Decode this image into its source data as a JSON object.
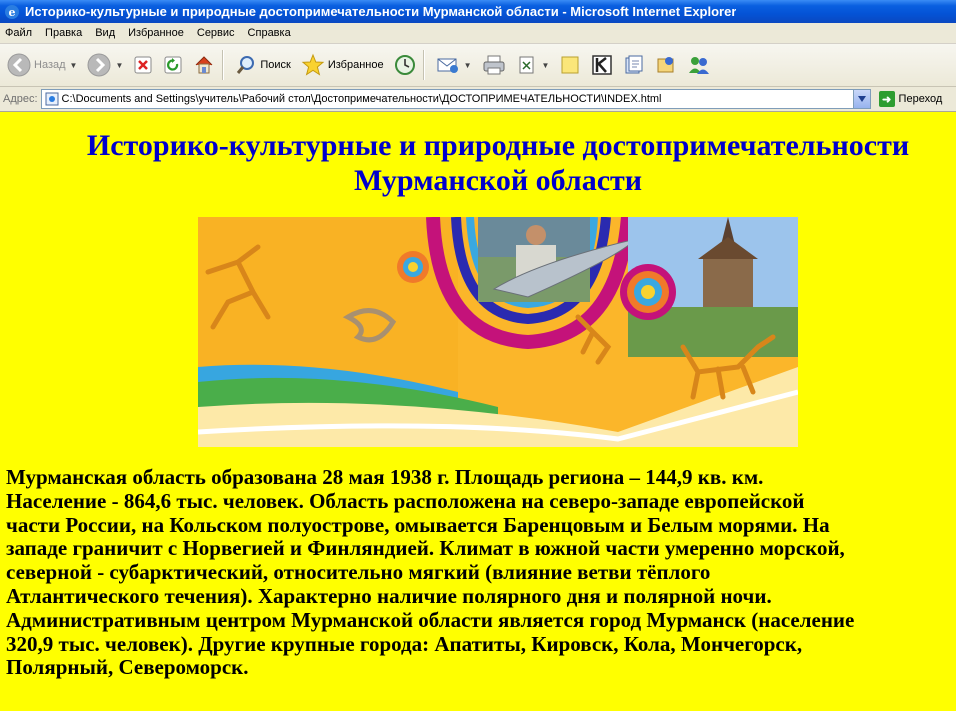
{
  "window": {
    "title": "Историко-культурные и природные достопримечательности Мурманской области - Microsoft Internet Explorer"
  },
  "menu": [
    "Файл",
    "Правка",
    "Вид",
    "Избранное",
    "Сервис",
    "Справка"
  ],
  "toolbar": {
    "back_label": "Назад",
    "search_label": "Поиск",
    "favorites_label": "Избранное"
  },
  "address": {
    "label": "Адрес:",
    "url": "C:\\Documents and Settings\\учитель\\Рабочий стол\\Достопримечательности\\ДОСТОПРИМЕЧАТЕЛЬНОСТИ\\INDEX.html",
    "go_label": "Переход"
  },
  "page": {
    "title_line1": "Историко-культурные и природные достопримечательности",
    "title_line2": "Мурманской области",
    "body_lines": [
      "Мурманская область образована 28 мая 1938 г. Площадь региона – 144,9 кв. км.",
      "Население - 864,6 тыс. человек. Область расположена на северо-западе европейской",
      "части России, на Кольском полуострове, омывается Баренцовым и Белым морями. На",
      "западе граничит с Норвегией и Финляндией. Климат в южной части умеренно морской,",
      "северной - субарктический, относительно мягкий (влияние ветви тёплого",
      "Атлантического течения). Характерно наличие полярного дня и полярной ночи.",
      "Административным центром Мурманской области является город Мурманск (население",
      "320,9 тыс. человек). Другие крупные города: Апатиты, Кировск, Кола, Мончегорск,",
      "Полярный, Североморск."
    ]
  },
  "colors": {
    "page_background": "#ffff00",
    "title_color": "#0000cc",
    "titlebar_blue": "#0453d6"
  }
}
